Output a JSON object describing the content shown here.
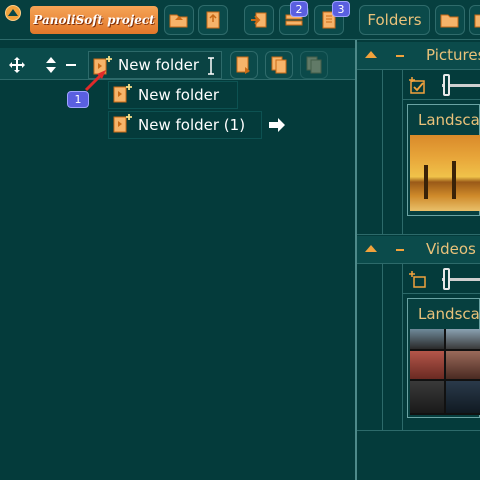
{
  "app": {
    "logo_text": "PanoliSoft project"
  },
  "toolbar": {
    "badge_1": "2",
    "badge_2": "3",
    "folders_label": "Folders"
  },
  "tree": {
    "edit_value": "New folder",
    "step_badge": "1",
    "items": [
      {
        "label": "New folder"
      },
      {
        "label": "New folder (1)"
      }
    ]
  },
  "panels": {
    "pictures": {
      "title": "Pictures",
      "card_title": "Landscap"
    },
    "videos": {
      "title": "Videos",
      "card_title": "Landscap"
    }
  },
  "colors": {
    "background": "#043b3b",
    "accent_orange": "#f1a23c",
    "badge_blue": "#5a5fe0",
    "panel_title": "#e9c27a"
  }
}
